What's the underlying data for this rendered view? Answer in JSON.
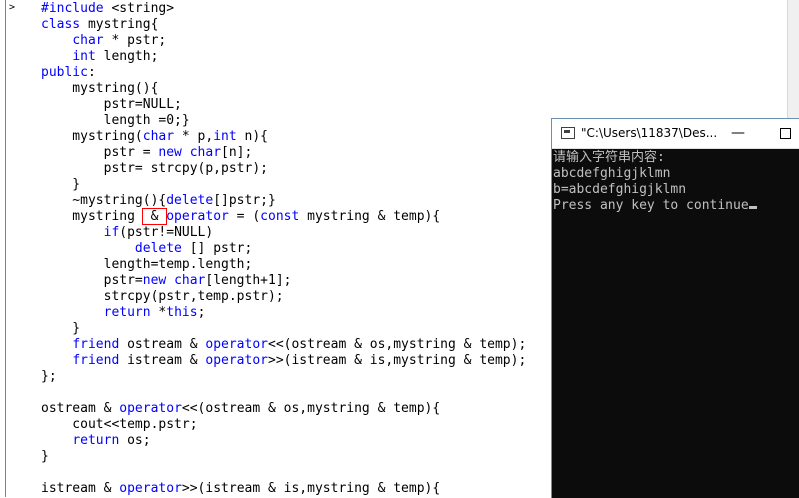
{
  "code_lines": [
    {
      "pre": "",
      "kw": "#include",
      "post": " <string>"
    },
    {
      "pre": "",
      "kw": "class",
      "post": " mystring{"
    },
    {
      "pre": "    ",
      "kw": "char",
      "post": " * pstr;"
    },
    {
      "pre": "    ",
      "kw": "int",
      "post": " length;"
    },
    {
      "pre": "",
      "kw": "public",
      "post": ":"
    },
    {
      "pre": "    mystring(){",
      "kw": "",
      "post": ""
    },
    {
      "pre": "        pstr=NULL;",
      "kw": "",
      "post": ""
    },
    {
      "pre": "        length =0;}",
      "kw": "",
      "post": ""
    },
    {
      "pre": "    mystring(",
      "kw": "char",
      "post": " * p,",
      "kw2": "int",
      "post2": " n){"
    },
    {
      "pre": "        pstr = ",
      "kw": "new",
      "post": " ",
      "kw2": "char",
      "post2": "[n];"
    },
    {
      "pre": "        pstr= strcpy(p,pstr);",
      "kw": "",
      "post": ""
    },
    {
      "pre": "    }",
      "kw": "",
      "post": ""
    },
    {
      "pre": "    ~mystring(){",
      "kw": "delete",
      "post": "[]pstr;}"
    },
    {
      "pre": "    mystring ",
      "hl": " & ",
      "kw": "operator",
      "post": " = (",
      "kw2": "const",
      "post2": " mystring & temp){"
    },
    {
      "pre": "        ",
      "kw": "if",
      "post": "(pstr!=NULL)"
    },
    {
      "pre": "            ",
      "kw": "delete",
      "post": " [] pstr;"
    },
    {
      "pre": "        length=temp.length;",
      "kw": "",
      "post": ""
    },
    {
      "pre": "        pstr=",
      "kw": "new",
      "post": " ",
      "kw2": "char",
      "post2": "[length+1];"
    },
    {
      "pre": "        strcpy(pstr,temp.pstr);",
      "kw": "",
      "post": ""
    },
    {
      "pre": "        ",
      "kw": "return",
      "post": " *",
      "kw2": "this",
      "post2": ";"
    },
    {
      "pre": "    }",
      "kw": "",
      "post": ""
    },
    {
      "pre": "    ",
      "kw": "friend",
      "post": " ostream & ",
      "kw2": "operator",
      "post2": "<<(ostream & os,mystring & temp);"
    },
    {
      "pre": "    ",
      "kw": "friend",
      "post": " istream & ",
      "kw2": "operator",
      "post2": ">>(istream & is,mystring & temp);"
    },
    {
      "pre": "};",
      "kw": "",
      "post": ""
    },
    {
      "pre": "",
      "kw": "",
      "post": ""
    },
    {
      "pre": "ostream & ",
      "kw": "operator",
      "post": "<<(ostream & os,mystring & temp){"
    },
    {
      "pre": "    cout<<temp.pstr;",
      "kw": "",
      "post": ""
    },
    {
      "pre": "    ",
      "kw": "return",
      "post": " os;"
    },
    {
      "pre": "}",
      "kw": "",
      "post": ""
    },
    {
      "pre": "",
      "kw": "",
      "post": ""
    },
    {
      "pre": "istream & ",
      "kw": "operator",
      "post": ">>(istream & is,mystring & temp){"
    }
  ],
  "console": {
    "title": "\"C:\\Users\\11837\\Des...",
    "minimize_symbol": "—",
    "lines": [
      "请输入字符串内容:",
      "abcdefghigjklmn",
      "b=abcdefghigjklmn",
      "Press any key to continue"
    ]
  },
  "left_gutter_arrow": ">",
  "colors": {
    "keyword": "#0000ff",
    "highlight_box": "#ff0000",
    "console_bg": "#0c0c0c",
    "console_text": "#c0c0c0"
  }
}
